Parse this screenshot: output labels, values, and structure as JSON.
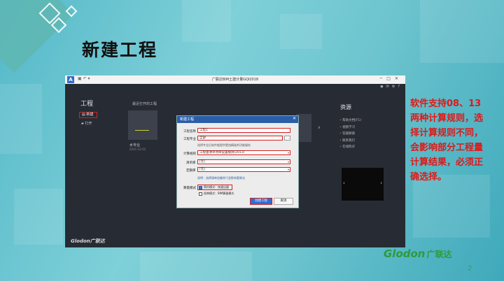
{
  "slide": {
    "title": "新建工程",
    "callout": "软件支持08、13两种计算规则，选择计算规则不同，会影响部分工程量计算结果，必须正确选择。",
    "logo_latin": "Glodon",
    "logo_cn": "广联达",
    "page_number": "2",
    "colors": {
      "callout": "#e01818",
      "logo": "#2e9a3c",
      "highlight_border": "#d62020",
      "accent_blue": "#2a5ea8"
    }
  },
  "screenshot": {
    "window_title": "广联达BIM土建计量GQI2018",
    "app_icon": "A",
    "toolbar_icons": [
      "save-icon",
      "undo-icon",
      "dropdown-icon"
    ],
    "window_controls": [
      "minimize-icon",
      "maximize-icon",
      "close-icon"
    ],
    "top_right_icons": [
      "user-icon",
      "message-icon",
      "settings-icon",
      "help-icon"
    ],
    "sidebar": {
      "title": "工程",
      "items": [
        {
          "label": "新建",
          "icon": "new-file-icon"
        },
        {
          "label": "打开",
          "icon": "folder-icon"
        }
      ]
    },
    "recent": {
      "title": "最近打开的工程",
      "items": [
        {
          "name": "水专业",
          "date": "2021-12-01"
        }
      ]
    },
    "resources": {
      "title": "资源",
      "items": [
        "帮助文档(F1)",
        "视频学习",
        "答疑解惑",
        "联系我们",
        "在线购买"
      ]
    },
    "brand": "Glodon广联达"
  },
  "dialog": {
    "title": "新建工程",
    "project_name_label": "工程名称",
    "project_name_value": "工程1",
    "specialty_label": "工程专业",
    "specialty_value": "全部",
    "specialty_note": "选择专业后软件能提供更加精准的功能服务",
    "calc_rule_label": "计算规则",
    "calc_rule_value": "工程量清单项目设置规则(2013)",
    "bill_lib_label": "清单库",
    "bill_lib_value": "[无]",
    "quota_lib_label": "定额库",
    "quota_lib_value": "[无]",
    "hint": "说明：选择清单定额库只会影响套做法",
    "mode_label": "算量模式",
    "mode_simple": "简约模式：快速出量",
    "mode_classic": "经典模式：BIM算量模式",
    "create_button": "创建工程",
    "cancel_button": "取消"
  }
}
